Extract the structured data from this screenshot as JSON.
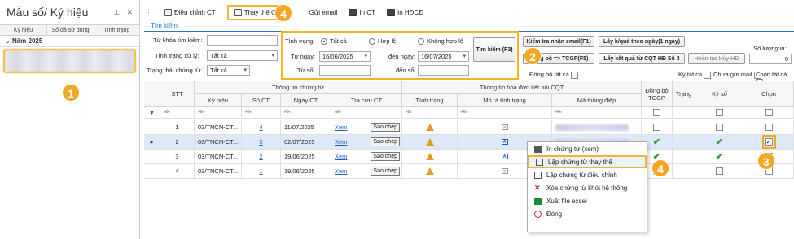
{
  "left_panel": {
    "title": "Mẫu số/ Ký hiệu",
    "pin_icons": [
      "pin-icon",
      "close-icon"
    ],
    "columns": [
      "Ký hiệu",
      "Số đã sử dụng",
      "Tình trạng"
    ],
    "group": "Năm 2025"
  },
  "toolbar": {
    "items": [
      {
        "label": "Điều chỉnh CT",
        "icon": "edit-icon"
      },
      {
        "label": "Thay thế CT",
        "icon": "replace-icon"
      },
      {
        "label": "Gửi email",
        "icon": "email-icon"
      },
      {
        "label": "In CT",
        "icon": "print-icon"
      },
      {
        "label": "In HĐCĐ",
        "icon": "print-icon"
      }
    ]
  },
  "tab": "Tìm kiếm",
  "search": {
    "keyword_label": "Từ khóa tìm kiếm:",
    "process_label": "Tình trạng xử lý:",
    "process_value": "Tất cả",
    "doc_status_label": "Trạng thái chứng từ:",
    "doc_status_value": "Tất cả",
    "status_label": "Tình trạng:",
    "radios": [
      "Tất cả",
      "Hợp lệ",
      "Không hợp lệ"
    ],
    "from_date_label": "Từ ngày:",
    "from_date": "16/06/2025",
    "to_date_label": "đến ngày:",
    "to_date": "16/07/2025",
    "from_no_label": "Từ số:",
    "to_no_label": "đến số:",
    "search_button": "Tìm kiếm (F3)"
  },
  "actions": {
    "check_email": "Kiểm tra nhận email(F1)",
    "get_kq": "Lấy k/quả theo ngày(1 ngày)",
    "sync_tcgp": "Đồng bộ => TCGP(F5)",
    "get_cqt": "Lấy kết quả từ CQT HĐ Số 3",
    "undo_cancel": "Hoàn tác Hủy HĐ",
    "quantity_label": "Số lượng in:",
    "quantity_value": "0",
    "sync_all": "Đồng bộ tất cả",
    "sign_all": "Ký tất cả",
    "not_sent": "Chưa gửi mail",
    "select_all": "Chọn tất cả"
  },
  "grid": {
    "group_headers": [
      "Thông tin chứng từ",
      "Thông tin hóa đơn kết nối CQT"
    ],
    "columns": [
      "STT",
      "Ký hiệu",
      "Số CT",
      "Ngày CT",
      "Tra cứu CT",
      "Tình trạng",
      "Mô tả tình trạng",
      "Mã thông điệp",
      "Đồng bộ TCGP",
      "Trạng",
      "Ký số",
      "Chọn"
    ],
    "filter_glyph": "ᴬᴮᶜ",
    "rows": [
      {
        "stt": "1",
        "ky_hieu": "03/TNCN-CT...",
        "so_ct": "4",
        "ngay": "11/07/2025",
        "xem": "Xem",
        "copy": "Sao chép",
        "desc": "a",
        "synced": false,
        "signed": false,
        "chosen": false
      },
      {
        "stt": "2",
        "ky_hieu": "03/TNCN-CT...",
        "so_ct": "3",
        "ngay": "02/07/2025",
        "xem": "Xem",
        "copy": "Sao chép",
        "desc": "A",
        "synced": true,
        "signed": true,
        "chosen": true
      },
      {
        "stt": "3",
        "ky_hieu": "03/TNCN-CT...",
        "so_ct": "2",
        "ngay": "19/06/2025",
        "xem": "Xem",
        "copy": "Sao chép",
        "desc": "A",
        "synced": true,
        "signed": true,
        "chosen": false
      },
      {
        "stt": "4",
        "ky_hieu": "03/TNCN-CT...",
        "so_ct": "1",
        "ngay": "19/06/2025",
        "xem": "Xem",
        "copy": "Sao chép",
        "desc": "a",
        "synced": false,
        "signed": false,
        "chosen": false
      }
    ]
  },
  "context_menu": [
    {
      "label": "In chứng từ (xem)",
      "icon": "print-icon"
    },
    {
      "label": "Lập chứng từ thay thế",
      "icon": "replace-doc-icon"
    },
    {
      "label": "Lập chứng từ điều chỉnh",
      "icon": "adjust-doc-icon"
    },
    {
      "label": "Xóa chứng từ khỏi hệ thống",
      "icon": "delete-icon"
    },
    {
      "label": "Xuất file excel",
      "icon": "excel-icon"
    },
    {
      "label": "Đóng",
      "icon": "close-circle-icon"
    }
  ],
  "badges": [
    "1",
    "2",
    "3",
    "4",
    "4"
  ],
  "colors": {
    "accent": "#f3a823",
    "link": "#1f5fbf",
    "selected_row": "#dde9f8",
    "tick": "#2e9b2e",
    "tab": "#2277cc"
  }
}
